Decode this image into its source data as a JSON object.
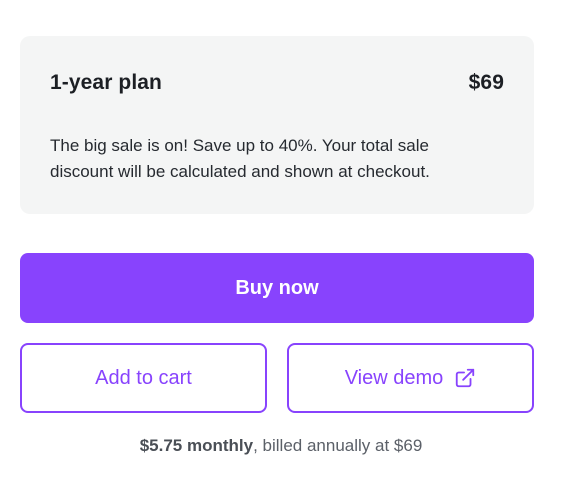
{
  "plan": {
    "name": "1-year plan",
    "price": "$69",
    "description": "The big sale is on! Save up to 40%. Your total sale discount will be calculated and shown at checkout."
  },
  "actions": {
    "buy_label": "Buy now",
    "cart_label": "Add to cart",
    "demo_label": "View demo",
    "demo_icon": "external-link-icon"
  },
  "billing": {
    "monthly": "$5.75 monthly",
    "annual": ", billed annually at $69"
  },
  "colors": {
    "accent": "#8843fd",
    "card_background": "#f4f5f5",
    "muted_text": "#5b6068"
  }
}
